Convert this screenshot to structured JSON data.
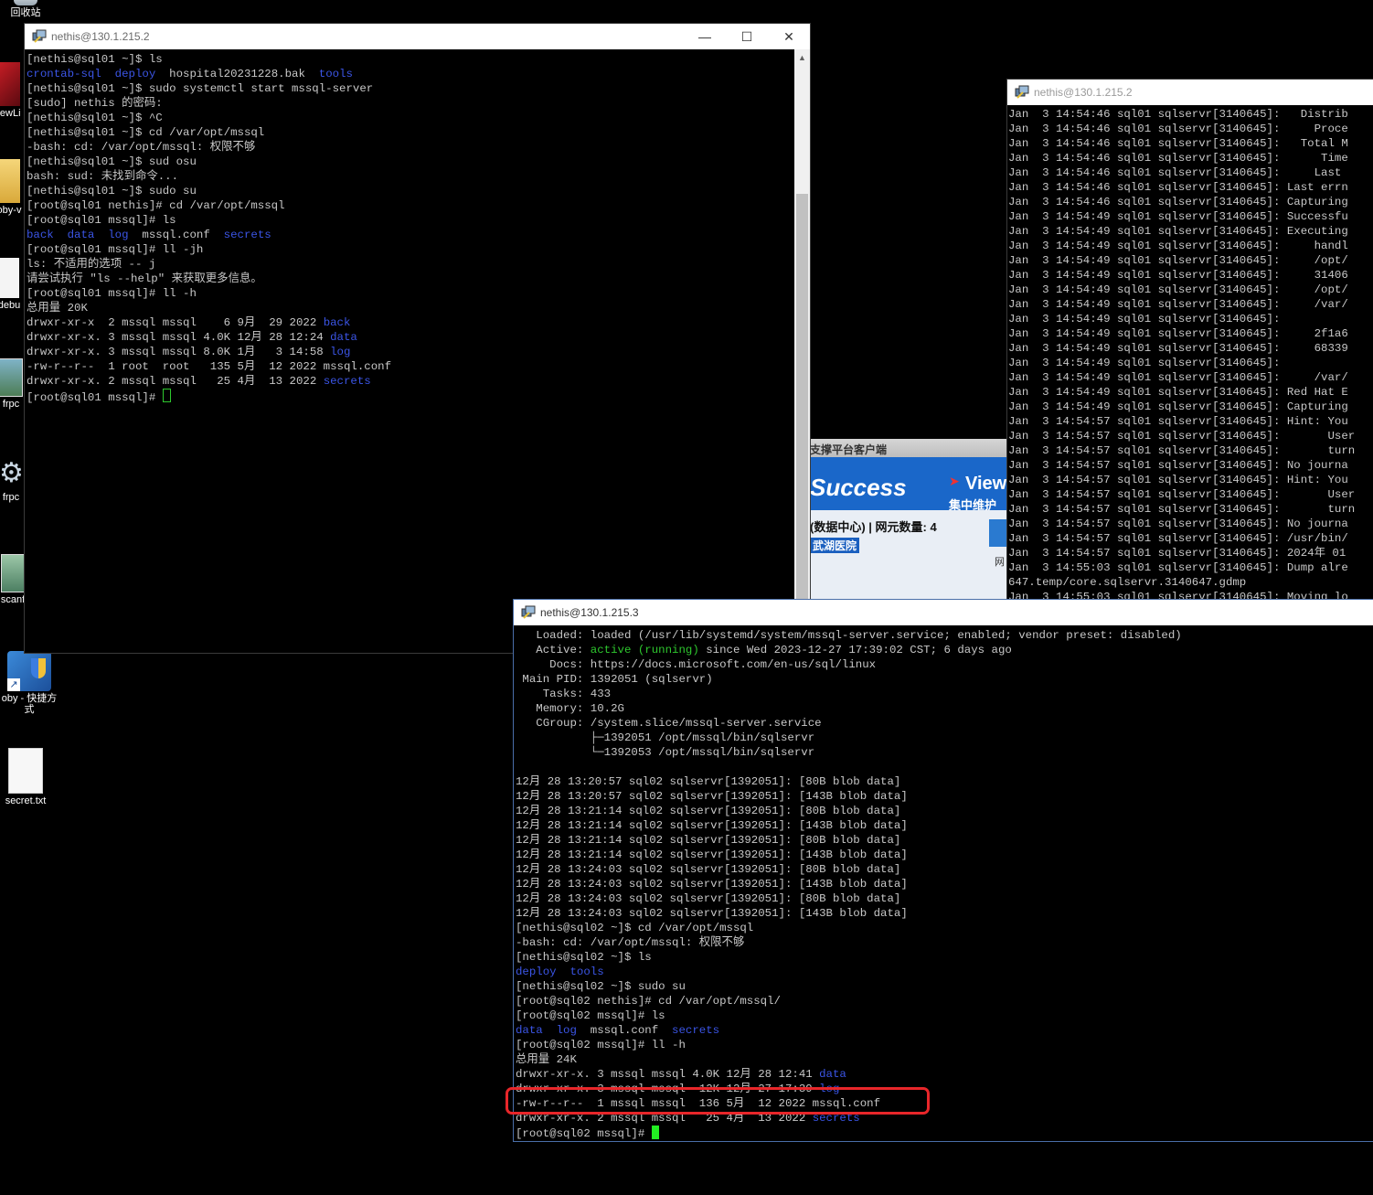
{
  "desktop": {
    "icons": [
      {
        "label": "回收站"
      },
      {
        "label": "iewLi"
      },
      {
        "label": "oby-v"
      },
      {
        "label": "debu"
      },
      {
        "label": "frpc"
      },
      {
        "label": "frpc"
      },
      {
        "label": "scanf"
      },
      {
        "label": "oby - 快捷方式"
      },
      {
        "label": "secret.txt"
      }
    ]
  },
  "bg_app": {
    "title": "支撑平台客户端",
    "brand_text": "Success",
    "brand_sub": "View",
    "brand_sub2": "集中维护",
    "info": "(数据中心) | 网元数量: 4",
    "hospital": "武湖医院",
    "side_glyph": "网"
  },
  "win1": {
    "title": "nethis@130.1.215.2",
    "lines": [
      [
        {
          "t": "[nethis@sql01 ~]$ ls"
        }
      ],
      [
        {
          "t": "crontab-sql",
          "c": "blue"
        },
        {
          "t": "  "
        },
        {
          "t": "deploy",
          "c": "blue"
        },
        {
          "t": "  hospital20231228.bak  "
        },
        {
          "t": "tools",
          "c": "blue"
        }
      ],
      [
        {
          "t": "[nethis@sql01 ~]$ sudo systemctl start mssql-server"
        }
      ],
      [
        {
          "t": "[sudo] nethis 的密码:"
        }
      ],
      [
        {
          "t": "[nethis@sql01 ~]$ ^C"
        }
      ],
      [
        {
          "t": "[nethis@sql01 ~]$ cd /var/opt/mssql"
        }
      ],
      [
        {
          "t": "-bash: cd: /var/opt/mssql: 权限不够"
        }
      ],
      [
        {
          "t": "[nethis@sql01 ~]$ sud osu"
        }
      ],
      [
        {
          "t": "bash: sud: 未找到命令..."
        }
      ],
      [
        {
          "t": "[nethis@sql01 ~]$ sudo su"
        }
      ],
      [
        {
          "t": "[root@sql01 nethis]# cd /var/opt/mssql"
        }
      ],
      [
        {
          "t": "[root@sql01 mssql]# ls"
        }
      ],
      [
        {
          "t": "back",
          "c": "blue"
        },
        {
          "t": "  "
        },
        {
          "t": "data",
          "c": "blue"
        },
        {
          "t": "  "
        },
        {
          "t": "log",
          "c": "blue"
        },
        {
          "t": "  mssql.conf  "
        },
        {
          "t": "secrets",
          "c": "blue"
        }
      ],
      [
        {
          "t": "[root@sql01 mssql]# ll -jh"
        }
      ],
      [
        {
          "t": "ls: 不适用的选项 -- j"
        }
      ],
      [
        {
          "t": "请尝试执行 \"ls --help\" 来获取更多信息。"
        }
      ],
      [
        {
          "t": "[root@sql01 mssql]# ll -h"
        }
      ],
      [
        {
          "t": "总用量 20K"
        }
      ],
      [
        {
          "t": "drwxr-xr-x  2 mssql mssql    6 9月  29 2022 "
        },
        {
          "t": "back",
          "c": "blue"
        }
      ],
      [
        {
          "t": "drwxr-xr-x. 3 mssql mssql 4.0K 12月 28 12:24 "
        },
        {
          "t": "data",
          "c": "blue"
        }
      ],
      [
        {
          "t": "drwxr-xr-x. 3 mssql mssql 8.0K 1月   3 14:58 "
        },
        {
          "t": "log",
          "c": "blue"
        }
      ],
      [
        {
          "t": "-rw-r--r--  1 root  root   135 5月  12 2022 mssql.conf"
        }
      ],
      [
        {
          "t": "drwxr-xr-x. 2 mssql mssql   25 4月  13 2022 "
        },
        {
          "t": "secrets",
          "c": "blue"
        }
      ],
      [
        {
          "t": "[root@sql01 mssql]# "
        },
        {
          "cursor": "box"
        }
      ]
    ]
  },
  "win2": {
    "title": "nethis@130.1.215.2",
    "lines": [
      "Jan  3 14:54:46 sql01 sqlservr[3140645]:   Distrib",
      "Jan  3 14:54:46 sql01 sqlservr[3140645]:     Proce",
      "Jan  3 14:54:46 sql01 sqlservr[3140645]:   Total M",
      "Jan  3 14:54:46 sql01 sqlservr[3140645]:      Time",
      "Jan  3 14:54:46 sql01 sqlservr[3140645]:     Last ",
      "Jan  3 14:54:46 sql01 sqlservr[3140645]: Last errn",
      "Jan  3 14:54:46 sql01 sqlservr[3140645]: Capturing",
      "Jan  3 14:54:49 sql01 sqlservr[3140645]: Successfu",
      "Jan  3 14:54:49 sql01 sqlservr[3140645]: Executing",
      "Jan  3 14:54:49 sql01 sqlservr[3140645]:     handl",
      "Jan  3 14:54:49 sql01 sqlservr[3140645]:     /opt/",
      "Jan  3 14:54:49 sql01 sqlservr[3140645]:     31406",
      "Jan  3 14:54:49 sql01 sqlservr[3140645]:     /opt/",
      "Jan  3 14:54:49 sql01 sqlservr[3140645]:     /var/",
      "Jan  3 14:54:49 sql01 sqlservr[3140645]:",
      "Jan  3 14:54:49 sql01 sqlservr[3140645]:     2f1a6",
      "Jan  3 14:54:49 sql01 sqlservr[3140645]:     68339",
      "Jan  3 14:54:49 sql01 sqlservr[3140645]:",
      "Jan  3 14:54:49 sql01 sqlservr[3140645]:     /var/",
      "Jan  3 14:54:49 sql01 sqlservr[3140645]: Red Hat E",
      "Jan  3 14:54:49 sql01 sqlservr[3140645]: Capturing",
      "Jan  3 14:54:57 sql01 sqlservr[3140645]: Hint: You",
      "Jan  3 14:54:57 sql01 sqlservr[3140645]:       User",
      "Jan  3 14:54:57 sql01 sqlservr[3140645]:       turn",
      "Jan  3 14:54:57 sql01 sqlservr[3140645]: No journa",
      "Jan  3 14:54:57 sql01 sqlservr[3140645]: Hint: You",
      "Jan  3 14:54:57 sql01 sqlservr[3140645]:       User",
      "Jan  3 14:54:57 sql01 sqlservr[3140645]:       turn",
      "Jan  3 14:54:57 sql01 sqlservr[3140645]: No journa",
      "Jan  3 14:54:57 sql01 sqlservr[3140645]: /usr/bin/",
      "Jan  3 14:54:57 sql01 sqlservr[3140645]: 2024年 01",
      "Jan  3 14:55:03 sql01 sqlservr[3140645]: Dump alre",
      "647.temp/core.sqlservr.3140647.gdmp",
      "Jan  3 14:55:03 sql01 sqlservr[3140645]: Moving lo"
    ]
  },
  "win3": {
    "title": "nethis@130.1.215.3",
    "lines": [
      [
        {
          "t": "   Loaded: loaded (/usr/lib/systemd/system/mssql-server.service; enabled; vendor preset: disabled)"
        }
      ],
      [
        {
          "t": "   Active: "
        },
        {
          "t": "active (running)",
          "c": "green"
        },
        {
          "t": " since Wed 2023-12-27 17:39:02 CST; 6 days ago"
        }
      ],
      [
        {
          "t": "     Docs: https://docs.microsoft.com/en-us/sql/linux"
        }
      ],
      [
        {
          "t": " Main PID: 1392051 (sqlservr)"
        }
      ],
      [
        {
          "t": "    Tasks: 433"
        }
      ],
      [
        {
          "t": "   Memory: 10.2G"
        }
      ],
      [
        {
          "t": "   CGroup: /system.slice/mssql-server.service"
        }
      ],
      [
        {
          "t": "           ├─1392051 /opt/mssql/bin/sqlservr"
        }
      ],
      [
        {
          "t": "           └─1392053 /opt/mssql/bin/sqlservr"
        }
      ],
      [
        {
          "t": ""
        }
      ],
      [
        {
          "t": "12月 28 13:20:57 sql02 sqlservr[1392051]: [80B blob data]"
        }
      ],
      [
        {
          "t": "12月 28 13:20:57 sql02 sqlservr[1392051]: [143B blob data]"
        }
      ],
      [
        {
          "t": "12月 28 13:21:14 sql02 sqlservr[1392051]: [80B blob data]"
        }
      ],
      [
        {
          "t": "12月 28 13:21:14 sql02 sqlservr[1392051]: [143B blob data]"
        }
      ],
      [
        {
          "t": "12月 28 13:21:14 sql02 sqlservr[1392051]: [80B blob data]"
        }
      ],
      [
        {
          "t": "12月 28 13:21:14 sql02 sqlservr[1392051]: [143B blob data]"
        }
      ],
      [
        {
          "t": "12月 28 13:24:03 sql02 sqlservr[1392051]: [80B blob data]"
        }
      ],
      [
        {
          "t": "12月 28 13:24:03 sql02 sqlservr[1392051]: [143B blob data]"
        }
      ],
      [
        {
          "t": "12月 28 13:24:03 sql02 sqlservr[1392051]: [80B blob data]"
        }
      ],
      [
        {
          "t": "12月 28 13:24:03 sql02 sqlservr[1392051]: [143B blob data]"
        }
      ],
      [
        {
          "t": "[nethis@sql02 ~]$ cd /var/opt/mssql"
        }
      ],
      [
        {
          "t": "-bash: cd: /var/opt/mssql: 权限不够"
        }
      ],
      [
        {
          "t": "[nethis@sql02 ~]$ ls"
        }
      ],
      [
        {
          "t": "deploy",
          "c": "blue"
        },
        {
          "t": "  "
        },
        {
          "t": "tools",
          "c": "blue"
        }
      ],
      [
        {
          "t": "[nethis@sql02 ~]$ sudo su"
        }
      ],
      [
        {
          "t": "[root@sql02 nethis]# cd /var/opt/mssql/"
        }
      ],
      [
        {
          "t": "[root@sql02 mssql]# ls"
        }
      ],
      [
        {
          "t": "data",
          "c": "blue"
        },
        {
          "t": "  "
        },
        {
          "t": "log",
          "c": "blue"
        },
        {
          "t": "  mssql.conf  "
        },
        {
          "t": "secrets",
          "c": "blue"
        }
      ],
      [
        {
          "t": "[root@sql02 mssql]# ll -h"
        }
      ],
      [
        {
          "t": "总用量 24K"
        }
      ],
      [
        {
          "t": "drwxr-xr-x. 3 mssql mssql 4.0K 12月 28 12:41 "
        },
        {
          "t": "data",
          "c": "blue"
        }
      ],
      [
        {
          "t": "drwxr-xr-x. 3 mssql mssql  12K 12月 27 17:39 "
        },
        {
          "t": "log",
          "c": "blue"
        }
      ],
      [
        {
          "t": "-rw-r--r--  1 mssql mssql  136 5月  12 2022 mssql.conf"
        }
      ],
      [
        {
          "t": "drwxr-xr-x. 2 mssql mssql   25 4月  13 2022 "
        },
        {
          "t": "secrets",
          "c": "blue"
        }
      ],
      [
        {
          "t": "[root@sql02 mssql]# "
        },
        {
          "cursor": "solid"
        }
      ]
    ]
  },
  "annotation": {
    "color": "#e8262a"
  }
}
